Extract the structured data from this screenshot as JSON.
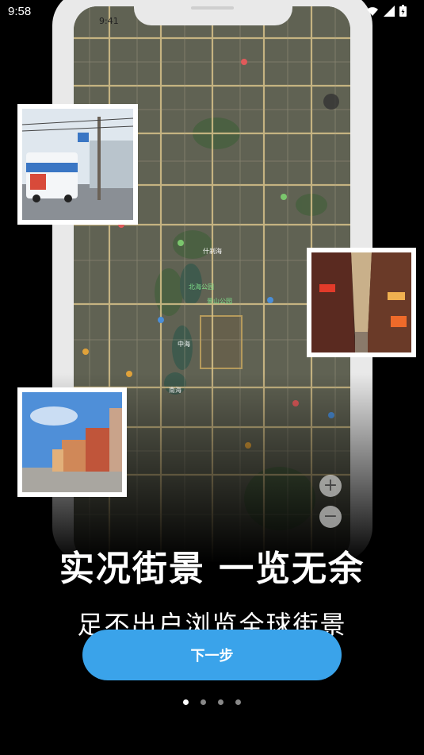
{
  "status_bar": {
    "time": "9:58"
  },
  "phone_screen": {
    "time": "9:41",
    "map_labels": [
      {
        "text": "北海公园",
        "green": true
      },
      {
        "text": "景山公园",
        "green": true
      },
      {
        "text": "中海",
        "green": false
      },
      {
        "text": "南海",
        "green": false
      },
      {
        "text": "什刹海",
        "green": false
      }
    ]
  },
  "headline": "实况街景  一览无余",
  "subline": "足不出户浏览全球街景",
  "next_button": "下一步",
  "pagination": {
    "total": 4,
    "current": 1
  },
  "colors": {
    "accent": "#3aa3ea",
    "background": "#000000"
  }
}
